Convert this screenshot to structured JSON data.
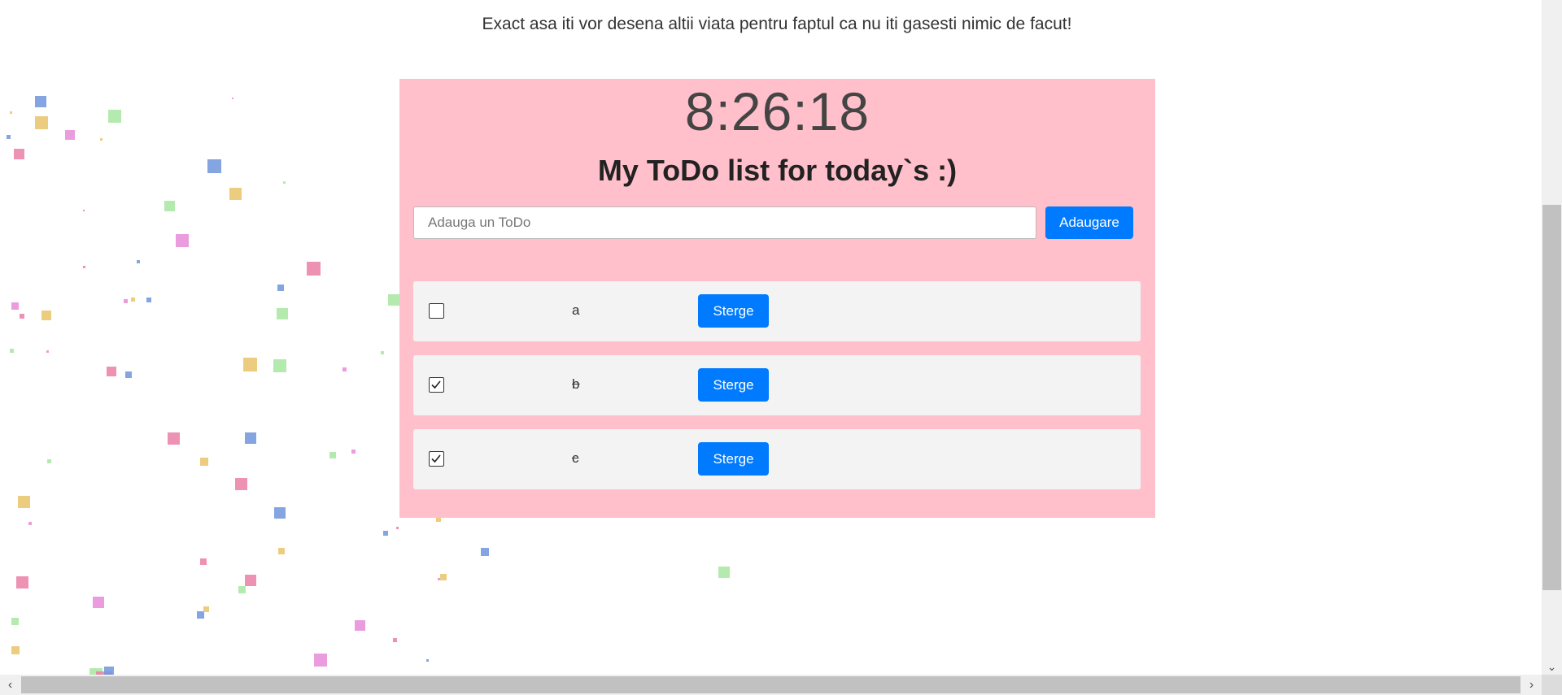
{
  "tagline": "Exact asa iti vor desena altii viata pentru faptul ca nu iti gasesti nimic de facut!",
  "clock": "8:26:18",
  "heading": "My ToDo list for today`s :)",
  "add_form": {
    "input_value": "",
    "placeholder": "Adauga un ToDo",
    "button_label": "Adaugare"
  },
  "todos": [
    {
      "text": "a",
      "done": false,
      "delete_label": "Sterge"
    },
    {
      "text": "b",
      "done": true,
      "delete_label": "Sterge"
    },
    {
      "text": "c",
      "done": true,
      "delete_label": "Sterge"
    }
  ],
  "colors": {
    "panel_bg": "#ffc0cb",
    "item_bg": "#f3f3f3",
    "accent": "#007bff",
    "confetti": [
      "#6f95dc",
      "#e9c46a",
      "#a8e6a1",
      "#e88bd9",
      "#ea7fa6"
    ]
  },
  "icons": {
    "checkbox_checked": "check-icon",
    "scroll_left": "chevron-left-icon",
    "scroll_right": "chevron-right-icon",
    "scroll_down": "chevron-down-icon"
  }
}
